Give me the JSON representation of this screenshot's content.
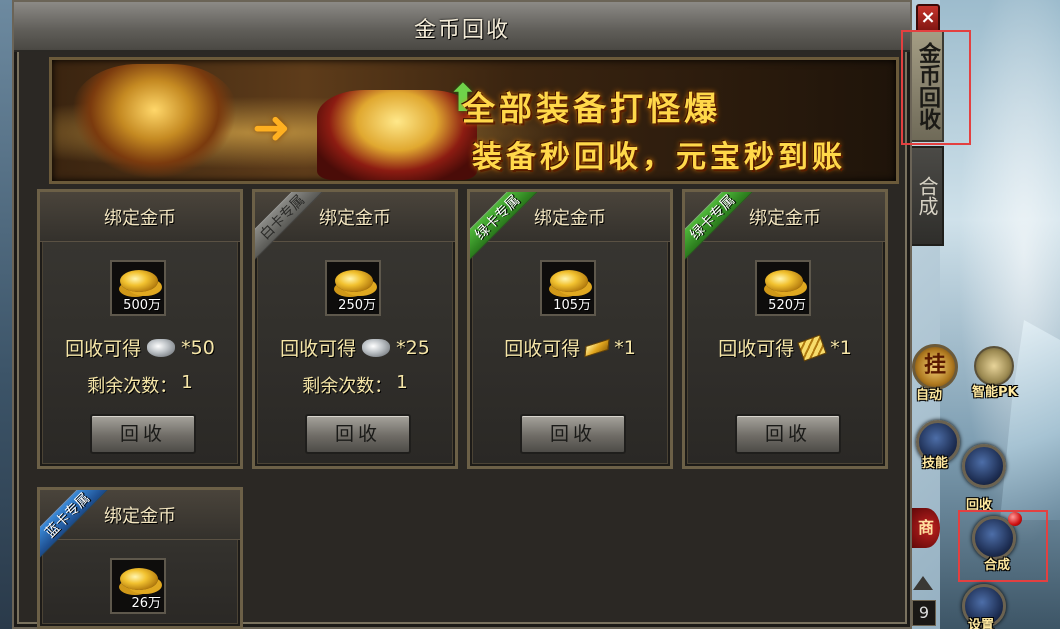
{
  "window": {
    "title": "金币回收",
    "close_label": "×"
  },
  "side_tabs": [
    {
      "label": "金币回收",
      "active": true
    },
    {
      "label": "合成",
      "active": false
    }
  ],
  "banner": {
    "line1": "全部装备打怪爆",
    "line2": "装备秒回收，元宝秒到账"
  },
  "cards": [
    {
      "title": "绑定金币",
      "ribbon": "",
      "amount": "500万",
      "reward_prefix": "回收可得",
      "reward_icon": "silver-ingot-icon",
      "reward_value": "*50",
      "remain_label": "剩余次数：",
      "remain_value": "1",
      "button": "回收"
    },
    {
      "title": "绑定金币",
      "ribbon": "白卡专属",
      "ribbon_color": "#7a7a76",
      "amount": "250万",
      "reward_prefix": "回收可得",
      "reward_icon": "silver-ingot-icon",
      "reward_value": "*25",
      "remain_label": "剩余次数：",
      "remain_value": "1",
      "button": "回收"
    },
    {
      "title": "绑定金币",
      "ribbon": "绿卡专属",
      "ribbon_color": "#3a9a2a",
      "amount": "105万",
      "reward_prefix": "回收可得",
      "reward_icon": "gold-bar-icon",
      "reward_value": "*1",
      "button": "回收"
    },
    {
      "title": "绑定金币",
      "ribbon": "绿卡专属",
      "ribbon_color": "#3a9a2a",
      "amount": "520万",
      "reward_prefix": "回收可得",
      "reward_icon": "gold-stack-icon",
      "reward_value": "*1",
      "button": "回收"
    },
    {
      "title": "绑定金币",
      "ribbon": "蓝卡专属",
      "ribbon_color": "#2a6ab8",
      "amount": "26万"
    }
  ],
  "right_ui": {
    "auto_label": "自动",
    "auto_glyph": "挂",
    "pk_label": "智能PK",
    "skill_label": "技能",
    "recycle_label": "回收",
    "merge_label": "合成",
    "settings_label": "设置",
    "shop_glyph": "商",
    "page_number": "9"
  },
  "colors": {
    "panel_bg": "#2b2824",
    "title_text": "#f4ecd8",
    "card_text": "#f6e6a8",
    "banner_text": "#ffd84a",
    "highlight": "#e34040"
  }
}
